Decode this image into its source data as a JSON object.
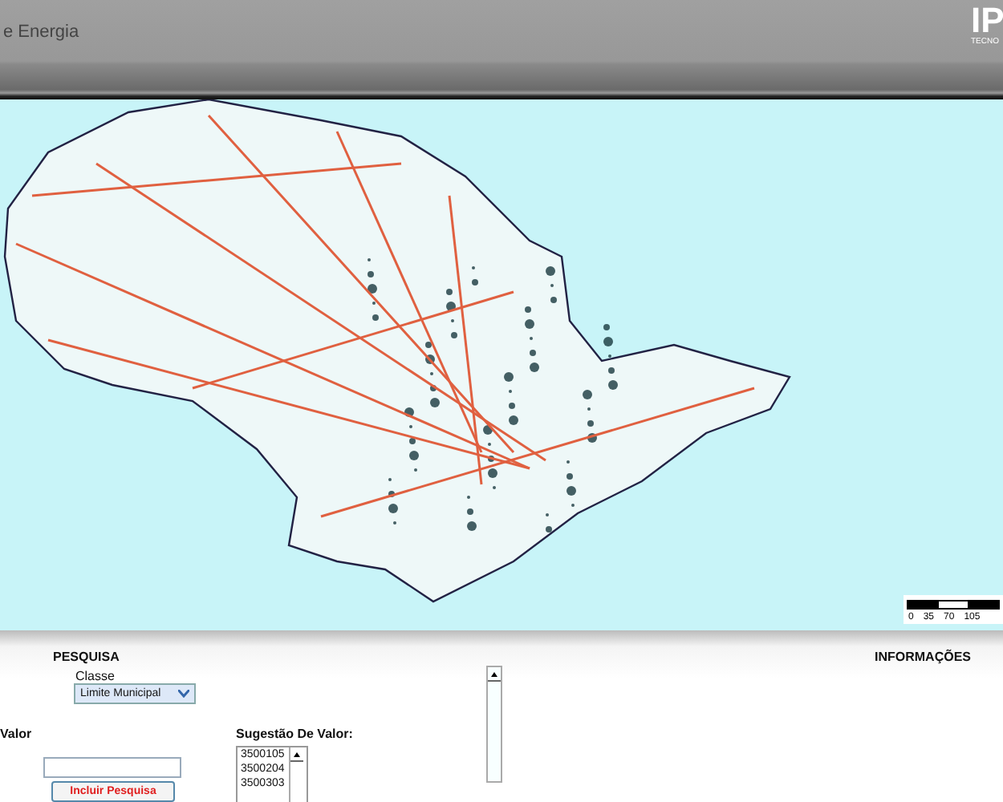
{
  "header": {
    "title": "e Energia",
    "logo": "IP",
    "logo_subtitle": "TECNO"
  },
  "map": {
    "scale_labels": [
      "0",
      "35",
      "70",
      "105"
    ]
  },
  "search": {
    "title": "PESQUISA",
    "class_label": "Classe",
    "class_value": "Limite Municipal",
    "value_label": "Valor",
    "suggestion_label": "Sugestão De Valor:",
    "suggestions": [
      "3500105",
      "3500204",
      "3500303"
    ],
    "button": "Incluir Pesquisa"
  },
  "info": {
    "title": "INFORMAÇÕES"
  }
}
